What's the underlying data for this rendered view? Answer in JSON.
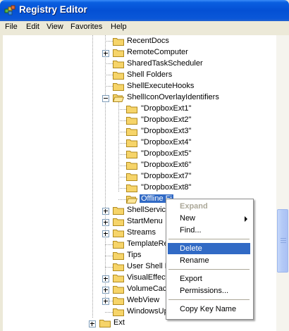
{
  "window": {
    "title": "Registry Editor",
    "app_icon": "registry-editor-icon"
  },
  "menu": [
    "File",
    "Edit",
    "View",
    "Favorites",
    "Help"
  ],
  "tree": {
    "items": [
      {
        "label": "RecentDocs"
      },
      {
        "label": "RemoteComputer"
      },
      {
        "label": "SharedTaskScheduler"
      },
      {
        "label": "Shell Folders"
      },
      {
        "label": "ShellExecuteHooks"
      },
      {
        "label": "ShellIconOverlayIdentifiers"
      },
      {
        "label": "\"DropboxExt1\""
      },
      {
        "label": "\"DropboxExt2\""
      },
      {
        "label": "\"DropboxExt3\""
      },
      {
        "label": "\"DropboxExt4\""
      },
      {
        "label": "\"DropboxExt5\""
      },
      {
        "label": "\"DropboxExt6\""
      },
      {
        "label": "\"DropboxExt7\""
      },
      {
        "label": "\"DropboxExt8\""
      },
      {
        "label": "Offline Fi"
      },
      {
        "label": "ShellService"
      },
      {
        "label": "StartMenu"
      },
      {
        "label": "Streams"
      },
      {
        "label": "TemplateRe"
      },
      {
        "label": "Tips"
      },
      {
        "label": "User Shell F"
      },
      {
        "label": "VisualEffect"
      },
      {
        "label": "VolumeCach"
      },
      {
        "label": "WebView"
      },
      {
        "label": "WindowsUp"
      },
      {
        "label": "Ext"
      }
    ]
  },
  "context_menu": {
    "expand": "Expand",
    "new": "New",
    "find": "Find...",
    "delete": "Delete",
    "rename": "Rename",
    "export": "Export",
    "permissions": "Permissions...",
    "copy_key_name": "Copy Key Name"
  },
  "colors": {
    "selection": "#316ac5",
    "folder": "#f6d469",
    "title_bar": "#0450d4",
    "window_bg": "#ece9d8"
  }
}
